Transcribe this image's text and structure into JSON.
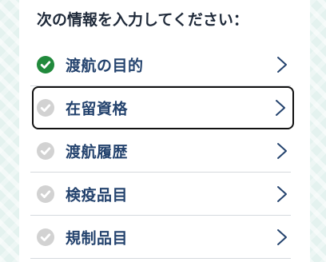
{
  "heading": "次の情報を入力してください：",
  "items": [
    {
      "label": "渡航の目的",
      "status_icon": "check-circle-icon",
      "complete": true
    },
    {
      "label": "在留資格",
      "status_icon": "check-circle-icon",
      "complete": false
    },
    {
      "label": "渡航履歴",
      "status_icon": "check-circle-icon",
      "complete": false
    },
    {
      "label": "検疫品目",
      "status_icon": "check-circle-icon",
      "complete": false
    },
    {
      "label": "規制品目",
      "status_icon": "check-circle-icon",
      "complete": false
    }
  ],
  "colors": {
    "complete": "#218a3c",
    "incomplete": "#d2d2d2",
    "label": "#24436e",
    "chevron": "#24436e",
    "focus_border": "#111111"
  }
}
